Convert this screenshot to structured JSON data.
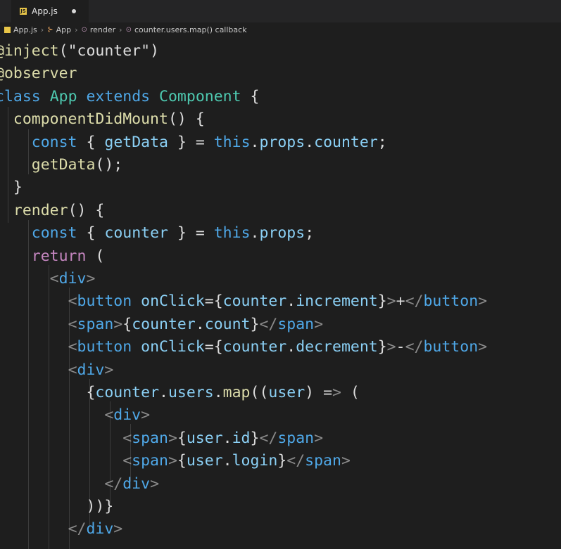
{
  "tab": {
    "label": "App.js",
    "icon": "js-file-icon"
  },
  "breadcrumb": [
    {
      "label": "App.js",
      "icon": "js-file-icon"
    },
    {
      "label": "App",
      "icon": "class-icon"
    },
    {
      "label": "render",
      "icon": "method-icon"
    },
    {
      "label": "counter.users.map() callback",
      "icon": "method-icon"
    }
  ],
  "code": [
    "@inject(\"counter\")",
    "@observer",
    "class App extends Component {",
    "  componentDidMount() {",
    "    const { getData } = this.props.counter;",
    "    getData();",
    "  }",
    "  render() {",
    "    const { counter } = this.props;",
    "    return (",
    "      <div>",
    "        <button onClick={counter.increment}>+</button>",
    "        <span>{counter.count}</span>",
    "        <button onClick={counter.decrement}>-</button>",
    "        <div>",
    "          {counter.users.map((user) => (",
    "            <div>",
    "              <span>{user.id}</span>",
    "              <span>{user.login}</span>",
    "            </div>",
    "          ))}",
    "        </div>"
  ]
}
